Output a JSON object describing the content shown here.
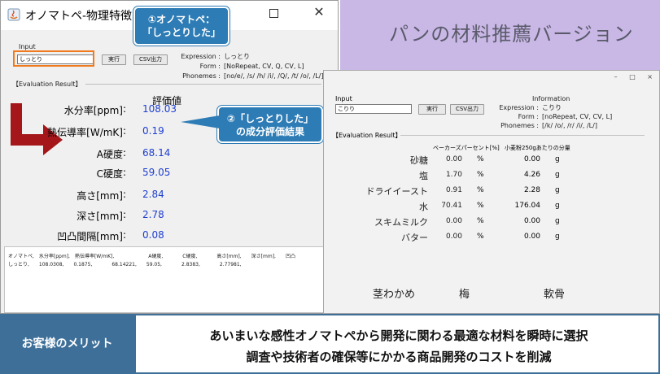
{
  "left_window": {
    "title": "オノマトペ-物理特徴",
    "input_label": "Input",
    "input_value": "しっとり",
    "run_button": "実行",
    "csv_button": "CSV出力",
    "expression_label": "Expression :",
    "expression_value": "しっとり",
    "form_label": "Form :",
    "form_value": "[NoRepeat, CV, Q, CV, L]",
    "phonemes_label": "Phonemes :",
    "phonemes_value": "[no/e/, /s/ /h/ /i/, /Q/, /t/ /o/, /L/]",
    "eval_header": "【Evaluation Result】",
    "eval_col_header": "評価値",
    "eval_rows": [
      {
        "label": "水分率[ppm]",
        "colon": ":",
        "value": "108.03"
      },
      {
        "label": "熱伝導率[W/mK]",
        "colon": ":",
        "value": "0.19"
      },
      {
        "label": "A硬度",
        "colon": ":",
        "value": "68.14"
      },
      {
        "label": "C硬度",
        "colon": ":",
        "value": "59.05"
      },
      {
        "label": "高さ[mm]",
        "colon": ":",
        "value": "2.84"
      },
      {
        "label": "深さ[mm]",
        "colon": ":",
        "value": "2.78"
      },
      {
        "label": "凹凸間隔[mm]",
        "colon": ":",
        "value": "0.08"
      }
    ],
    "csv_header": "オノマトペ,　水分率[ppm],　熱伝導率[W/mK],　　　　　　　A硬度,　　　　C硬度,　　　　高さ[mm],　　深さ[mm],　　凹凸",
    "csv_values": "しっとり,　　108.0308,　　0.1875,　　　　68.14221,　　59.05,　　　　2.8383,　　　　2.77981,"
  },
  "callouts": {
    "callout1_line1": "①オノマトペ：",
    "callout1_line2": "「しっとりした」",
    "callout2_line1": "②「しっとりした」",
    "callout2_line2": "の成分評価結果"
  },
  "banner": {
    "title": "パンの材料推薦バージョン",
    "color": "#c9b8e6"
  },
  "right_window": {
    "controls": [
      "–",
      "□",
      "×"
    ],
    "input_label": "Input",
    "input_value": "こりり",
    "run_button": "実行",
    "csv_button": "CSV出力",
    "info_title": "Information",
    "expression_label": "Expression :",
    "expression_value": "こりり",
    "form_label": "Form :",
    "form_value": "[noRepeat, CV, CV, L]",
    "phonemes_label": "Phonemes :",
    "phonemes_value": "[/k/ /o/, /r/ /i/, /L/]",
    "eval_header": "【Evaluation Result】",
    "col_percent": "ベーカーズパーセント[%]",
    "col_grams": "小麦粉250gあたりの分量",
    "ingredients": [
      {
        "name": "砂糖",
        "percent": "0.00",
        "pct_unit": "%",
        "grams": "0.00",
        "g_unit": "g"
      },
      {
        "name": "塩",
        "percent": "1.70",
        "pct_unit": "%",
        "grams": "4.26",
        "g_unit": "g"
      },
      {
        "name": "ドライイースト",
        "percent": "0.91",
        "pct_unit": "%",
        "grams": "2.28",
        "g_unit": "g"
      },
      {
        "name": "水",
        "percent": "70.41",
        "pct_unit": "%",
        "grams": "176.04",
        "g_unit": "g"
      },
      {
        "name": "スキムミルク",
        "percent": "0.00",
        "pct_unit": "%",
        "grams": "0.00",
        "g_unit": "g"
      },
      {
        "name": "バター",
        "percent": "0.00",
        "pct_unit": "%",
        "grams": "0.00",
        "g_unit": "g"
      }
    ],
    "extras": [
      "茎わかめ",
      "梅",
      "軟骨"
    ]
  },
  "bottom": {
    "merit_label": "お客様のメリット",
    "line1": "あいまいな感性オノマトペから開発に関わる最適な材料を瞬時に選択",
    "line2": "調査や技術者の確保等にかかる商品開発のコストを削減",
    "accent": "#3d6f98"
  }
}
